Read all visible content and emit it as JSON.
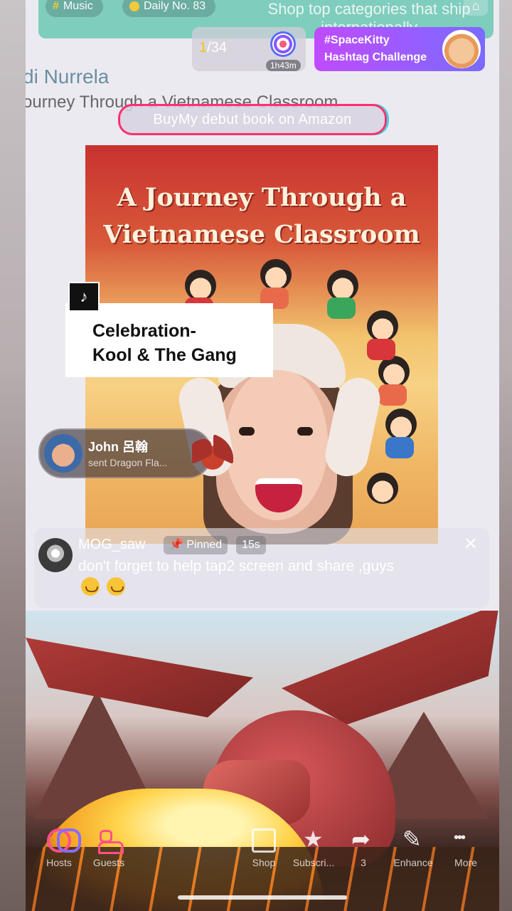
{
  "top_banner": {
    "chip_music": "Music",
    "chip_daily": "Daily No. 83",
    "promo_text": "Shop top categories that ship internationally"
  },
  "rank_widget": {
    "count_highlight": "1",
    "count_rest": "/34",
    "timer": "1h43m"
  },
  "hashtag_widget": {
    "tag": "#SpaceKitty",
    "label": "Hashtag Challenge"
  },
  "host": {
    "name": "di Nurrela",
    "subtitle": "ourney Through a Vietnamese Classroom"
  },
  "promo_pill": "BuyMy debut book on Amazon",
  "book": {
    "title_line1": "A Journey Through a",
    "title_line2": "Vietnamese Classroom"
  },
  "music_card": {
    "line1": "Celebration-",
    "line2": "Kool & The Gang"
  },
  "gift_notification": {
    "user": "John 呂翰",
    "description": "sent Dragon Fla..."
  },
  "pinned_comment": {
    "user": "MOG_saw",
    "badge": "Pinned",
    "age": "15s",
    "text": "don't  forget to help tap2 screen and share ,guys"
  },
  "actions": {
    "hosts": "Hosts",
    "guests": "Guests",
    "shop": "Shop",
    "subscribe": "Subscri...",
    "share_count": "3",
    "enhance": "Enhance",
    "more": "More"
  },
  "colors": {
    "promo_border": "#ff2f6e",
    "hashtag_from": "#c04bff",
    "hashtag_to": "#7a6bff",
    "banner": "#6cc9b5"
  }
}
